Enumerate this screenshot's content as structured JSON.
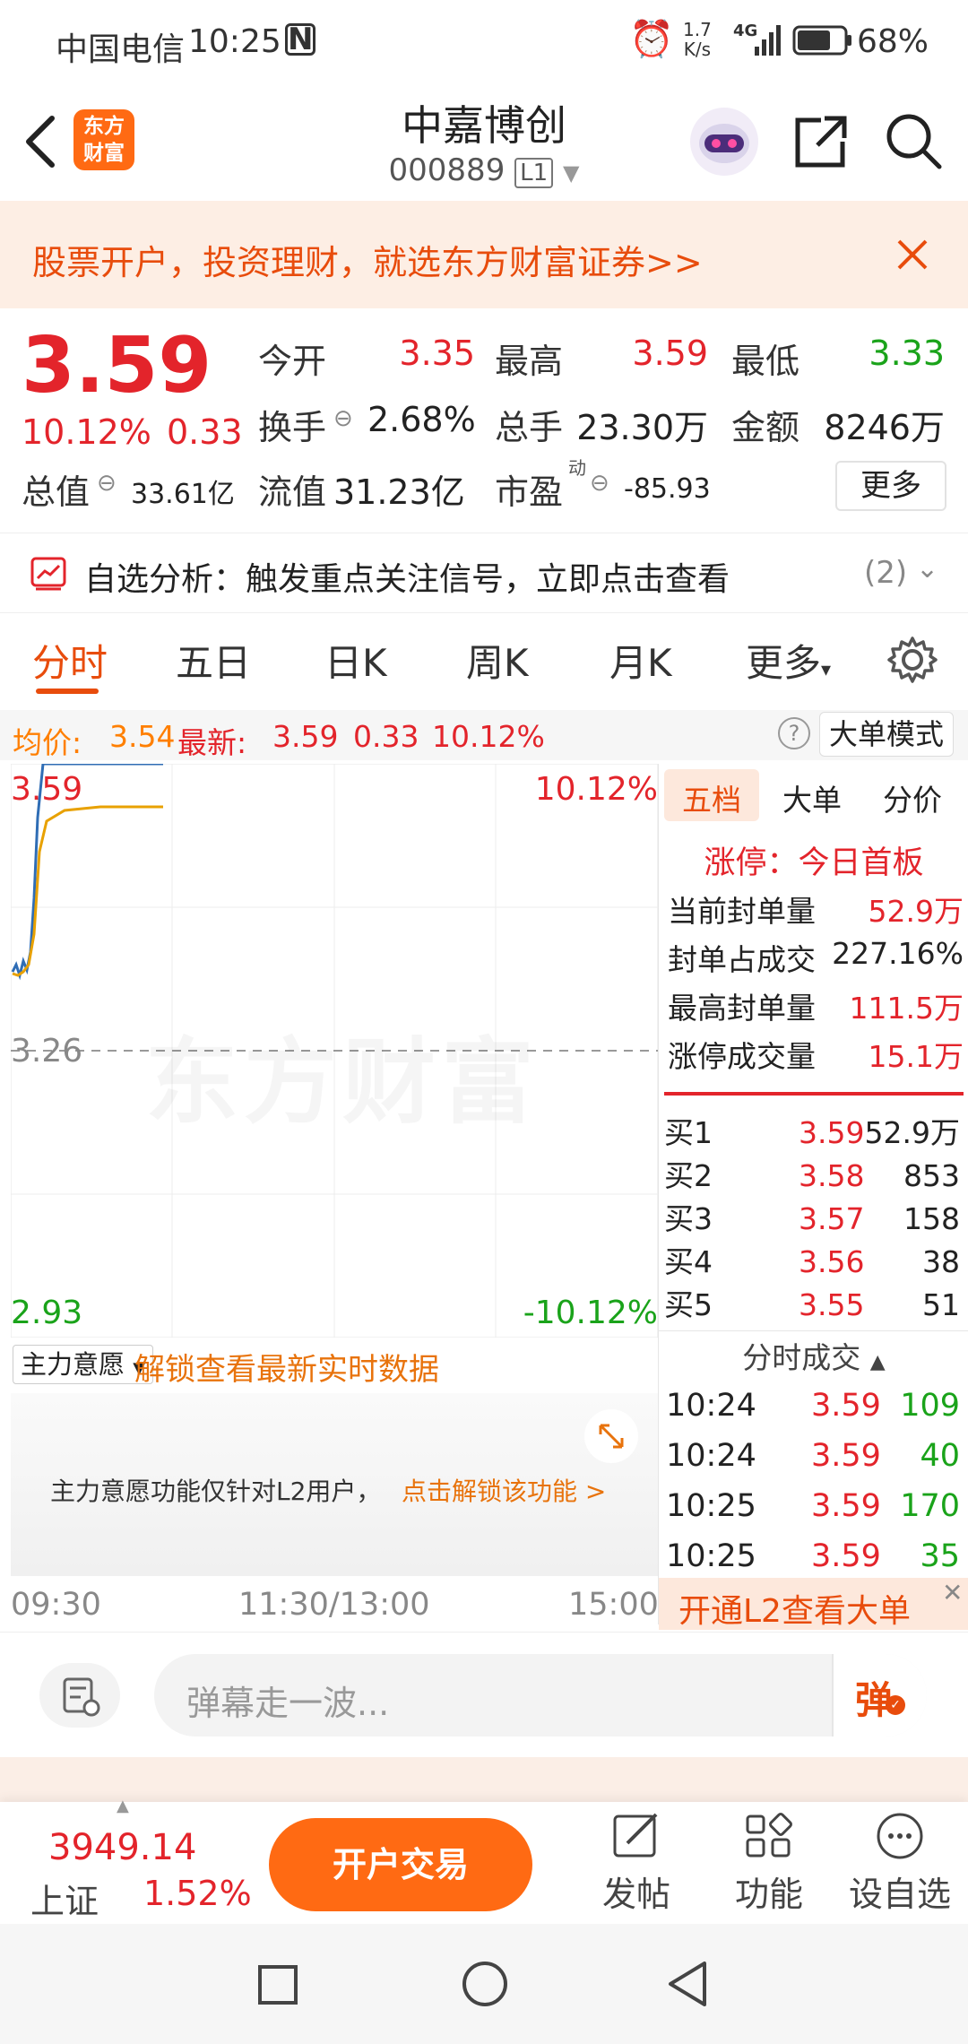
{
  "status_bar": {
    "carrier": "中国电信",
    "time": "10:25",
    "speed_top": "1.7",
    "speed_unit": "K/s",
    "net": "4G",
    "battery": "68%"
  },
  "header": {
    "stock_name": "中嘉博创",
    "stock_code": "000889",
    "level": "L1",
    "logo_line1": "东方",
    "logo_line2": "财富"
  },
  "banner": {
    "text": "股票开户，投资理财，就选东方财富证券>>"
  },
  "quote": {
    "price": "3.59",
    "change_pct": "10.12%",
    "change": "0.33",
    "open_label": "今开",
    "open": "3.35",
    "high_label": "最高",
    "high": "3.59",
    "low_label": "最低",
    "low": "3.33",
    "turnover_label": "换手",
    "turnover": "2.68%",
    "volume_label": "总手",
    "volume": "23.30万",
    "amount_label": "金额",
    "amount": "8246万",
    "mktcap_label": "总值",
    "mktcap": "33.61亿",
    "float_label": "流值",
    "float": "31.23亿",
    "pe_label": "市盈",
    "pe_sup": "动",
    "pe": "-85.93",
    "more_button": "更多"
  },
  "alert": {
    "text": "自选分析：触发重点关注信号，立即点击查看",
    "count": "(2)"
  },
  "tabs": [
    "分时",
    "五日",
    "日K",
    "周K",
    "月K",
    "更多"
  ],
  "info_line": {
    "avg_label": "均价:",
    "avg": "3.54",
    "latest_label": "最新:",
    "latest": "3.59",
    "chg": "0.33",
    "pct": "10.12%",
    "mode_button": "大单模式"
  },
  "chart": {
    "top_price": "3.59",
    "top_pct": "10.12%",
    "mid_price": "3.26",
    "bottom_price": "2.93",
    "bottom_pct": "-10.12%",
    "watermark": "东方财富",
    "price_line_color": "#2f6db5",
    "avg_line_color": "#e8a100"
  },
  "right_panel": {
    "tabs": [
      "五档",
      "大单",
      "分价"
    ],
    "limit_label": "涨停：今日首板",
    "stats": [
      {
        "label": "当前封单量",
        "value": "52.9万"
      },
      {
        "label": "封单占成交",
        "value": "227.16%"
      },
      {
        "label": "最高封单量",
        "value": "111.5万"
      },
      {
        "label": "涨停成交量",
        "value": "15.1万"
      }
    ],
    "bids": [
      {
        "label": "买1",
        "price": "3.59",
        "vol": "52.9万"
      },
      {
        "label": "买2",
        "price": "3.58",
        "vol": "853"
      },
      {
        "label": "买3",
        "price": "3.57",
        "vol": "158"
      },
      {
        "label": "买4",
        "price": "3.56",
        "vol": "38"
      },
      {
        "label": "买5",
        "price": "3.55",
        "vol": "51"
      }
    ],
    "ticks_title": "分时成交",
    "ticks": [
      {
        "time": "10:24",
        "price": "3.59",
        "vol": "109"
      },
      {
        "time": "10:24",
        "price": "3.59",
        "vol": "40"
      },
      {
        "time": "10:25",
        "price": "3.59",
        "vol": "170"
      },
      {
        "time": "10:25",
        "price": "3.59",
        "vol": "35"
      }
    ],
    "l2_button": "开通L2查看大单"
  },
  "zlyy": {
    "select": "主力意愿",
    "unlock_text": "解锁查看最新实时数据",
    "desc": "主力意愿功能仅针对L2用户，",
    "link": "点击解锁该功能 >"
  },
  "time_axis": [
    "09:30",
    "11:30/13:00",
    "15:00"
  ],
  "danmu": {
    "placeholder": "弹幕走一波...",
    "button": "弹"
  },
  "bottom": {
    "index_value": "3949.14",
    "index_name": "上证",
    "index_pct": "1.52%",
    "trade_button": "开户交易",
    "post": "发帖",
    "func": "功能",
    "add": "设自选"
  }
}
